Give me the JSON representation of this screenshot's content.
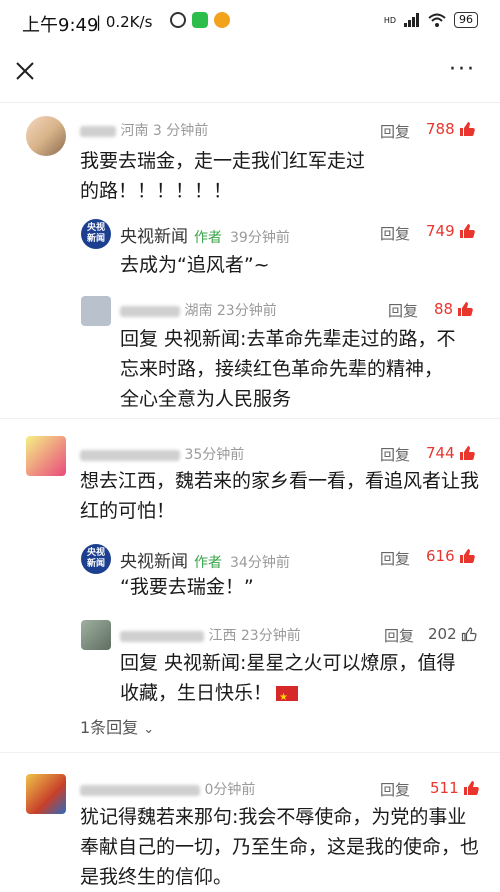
{
  "status_bar": {
    "time": "上午9:49",
    "net_speed": "| 0.2K/s",
    "signal": "HD",
    "battery": "96"
  },
  "top_bar": {
    "close_icon": "close-icon",
    "more_icon": "more-icon",
    "more_label": "···"
  },
  "labels": {
    "reply": "回复",
    "author": "作者"
  },
  "colors": {
    "like_red": "#e8362e",
    "author_green": "#3aa64a",
    "cctv_blue": "#1d3f8f"
  },
  "comments": [
    {
      "meta_time": "河南 3 分钟前",
      "likes": "788",
      "text": "我要去瑞金，走一走我们红军走过的路！！！！！！",
      "replies": [
        {
          "name": "央视新闻",
          "time": "39分钟前",
          "likes": "749",
          "text": "去成为“追风者”~"
        },
        {
          "meta_time": "湖南 23分钟前",
          "likes": "88",
          "reply_to": "回复 央视新闻:",
          "text": "去革命先辈走过的路，不忘来时路，接续红色革命先辈的精神，全心全意为人民服务"
        }
      ]
    },
    {
      "meta_time": "35分钟前",
      "likes": "744",
      "text": "想去江西，魏若来的家乡看一看，看追风者让我红的可怕！",
      "replies": [
        {
          "name": "央视新闻",
          "time": "34分钟前",
          "likes": "616",
          "text": "“我要去瑞金！”"
        },
        {
          "meta_time": "江西 23分钟前",
          "likes": "202",
          "reply_to": "回复 央视新闻:",
          "text": "星星之火可以燎原，值得收藏，生日快乐！"
        }
      ],
      "more_replies": "1条回复"
    },
    {
      "meta_time": "0分钟前",
      "likes": "511",
      "text": "犹记得魏若来那句:我会不辱使命，为党的事业奉献自己的一切，乃至生命，这是我的使命，也是我终生的信仰。"
    }
  ]
}
